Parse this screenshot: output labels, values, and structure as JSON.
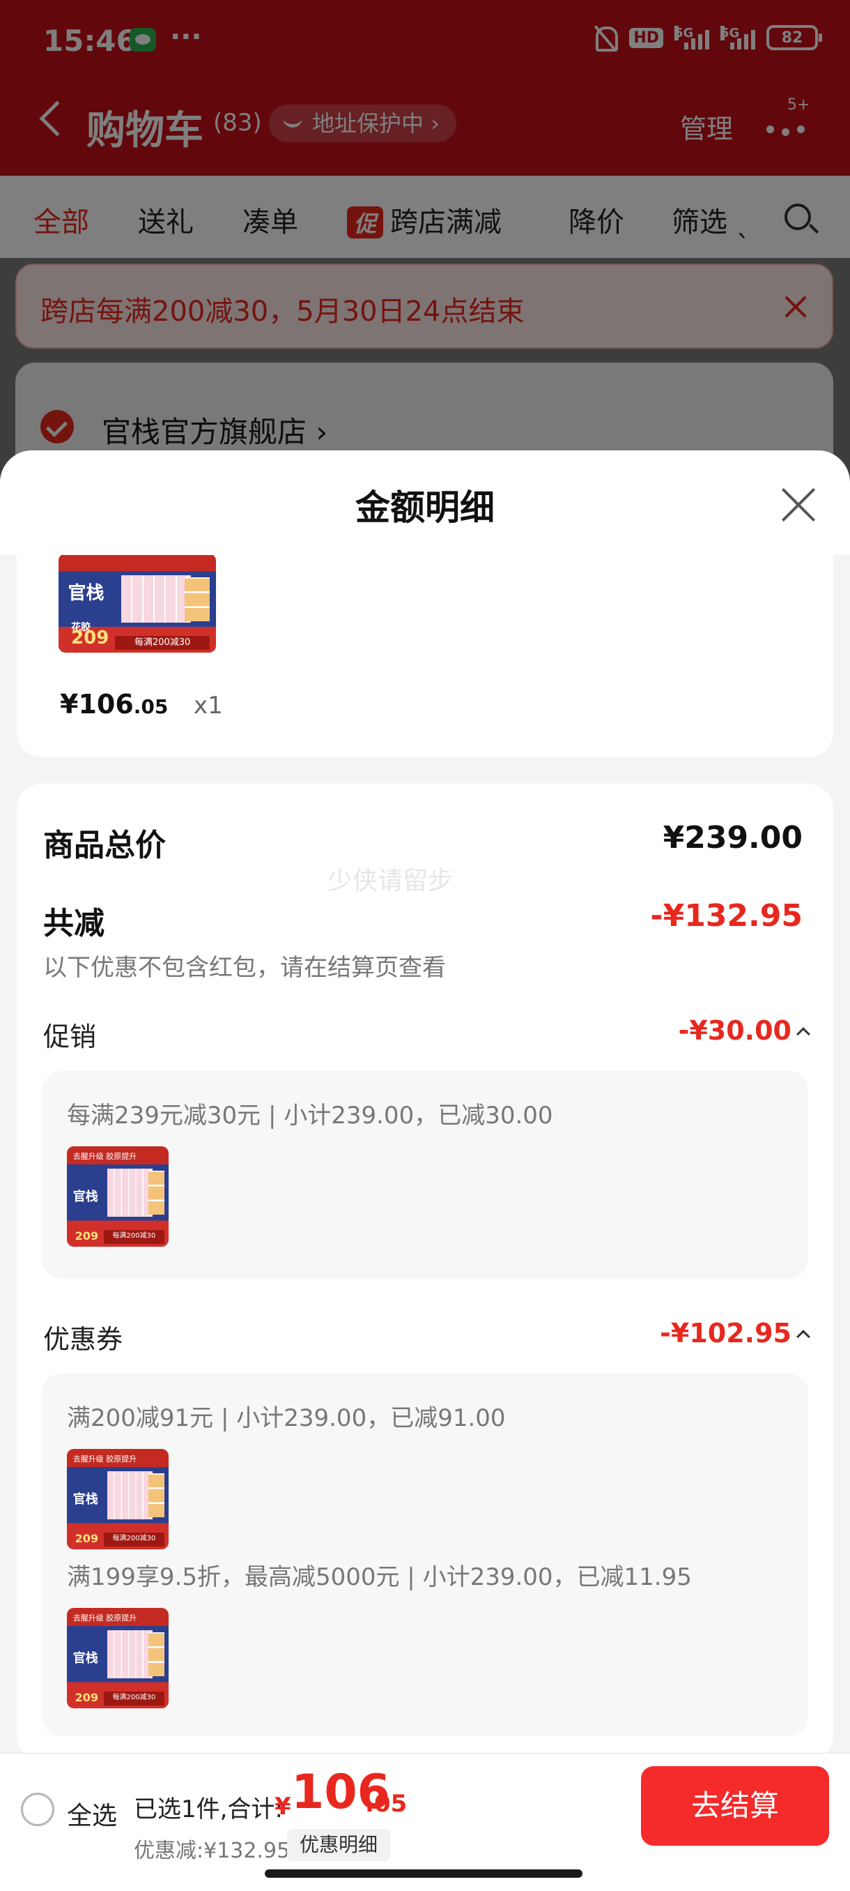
{
  "status_bar": {
    "time": "15:46",
    "notif_dots": "···",
    "hd_label": "HD",
    "signal1_label": "5G",
    "signal2_label": "5G",
    "battery": "82"
  },
  "nav": {
    "title": "购物车",
    "count": "(83)",
    "address_protect": "地址保护中 ›",
    "manage": "管理",
    "more_badge": "5+"
  },
  "filters": {
    "tabs": [
      {
        "label": "全部",
        "active": true
      },
      {
        "label": "送礼"
      },
      {
        "label": "凑单"
      },
      {
        "label": "跨店满减",
        "tag": "促"
      },
      {
        "label": "降价"
      },
      {
        "label": "筛选 ˎ"
      }
    ]
  },
  "banner": {
    "text": "跨店每满200减30，5月30日24点结束"
  },
  "store": {
    "name": "官栈官方旗舰店 ›"
  },
  "sheet": {
    "title": "金额明细",
    "item": {
      "thumb_brand": "官栈",
      "thumb_sub": "花胶",
      "thumb_price": "209",
      "thumb_strip": "每满200减30",
      "price_int": "¥106",
      "price_dec": ".05",
      "qty": "x1"
    },
    "summary": {
      "total_label": "商品总价",
      "total_value": "¥239.00",
      "discount_label": "共减",
      "discount_value": "-¥132.95",
      "watermark": "少侠请留步",
      "note": "以下优惠不包含红包，请在结算页查看",
      "promotion": {
        "label": "促销",
        "value": "-¥30.00",
        "detail": "每满239元减30元 | 小计239.00，已减30.00"
      },
      "coupon": {
        "label": "优惠券",
        "value": "-¥102.95",
        "detail1": "满200减91元 | 小计239.00，已减91.00",
        "detail2": "满199享9.5折，最高减5000元 | 小计239.00，已减11.95"
      },
      "thumb_top": "去腥升级 胶原提升",
      "thumb_brand": "官栈",
      "thumb_price": "209",
      "thumb_strip": "每满200减30"
    }
  },
  "bottom_bar": {
    "select_all": "全选",
    "selected_info": "已选1件,合计:",
    "total_sign": "¥",
    "total_int": "106",
    "total_dec": ".05",
    "discount_info": "优惠减:¥132.95",
    "detail_button": "优惠明细",
    "checkout_button": "去结算"
  },
  "colors": {
    "accent_red": "#e8281e",
    "header_red": "#c4111b",
    "checkout_red": "#f52a2a"
  }
}
